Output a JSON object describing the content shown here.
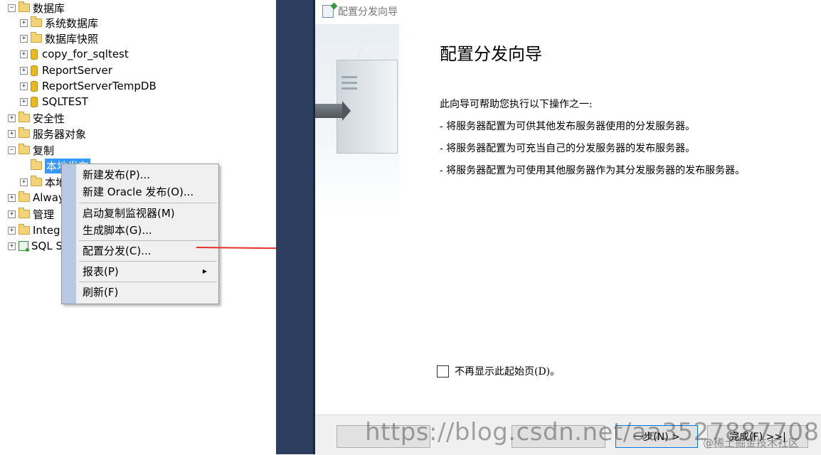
{
  "tree": {
    "databases": "数据库",
    "system_dbs": "系统数据库",
    "db_snapshots": "数据库快照",
    "db1": "copy_for_sqltest",
    "db2": "ReportServer",
    "db3": "ReportServerTempDB",
    "db4": "SQLTEST",
    "security": "安全性",
    "server_objects": "服务器对象",
    "replication": "复制",
    "local_publications": "本地发布",
    "local_subscriptions": "本地",
    "alwayson": "Alway",
    "management": "管理",
    "integration": "Integ",
    "sql_agent": "SQL S"
  },
  "context_menu": {
    "new_publication": "新建发布(P)...",
    "new_oracle_publication": "新建 Oracle 发布(O)...",
    "launch_monitor": "启动复制监视器(M)",
    "generate_scripts": "生成脚本(G)...",
    "configure_distribution": "配置分发(C)...",
    "reports": "报表(P)",
    "refresh": "刷新(F)"
  },
  "wizard": {
    "window_title": "配置分发向导",
    "heading": "配置分发向导",
    "intro": "此向导可帮助您执行以下操作之一:",
    "bullets": [
      "- 将服务器配置为可供其他发布服务器使用的分发服务器。",
      "- 将服务器配置为可充当自己的分发服务器的发布服务器。",
      "- 将服务器配置为可使用其他服务器作为其分发服务器的发布服务器。"
    ],
    "checkbox_label": "不再显示此起始页(D)。",
    "checkbox_checked": false,
    "buttons": {
      "next": "一步(N) >",
      "finish": "完成(F) >>|"
    }
  },
  "watermark": {
    "url": "https://blog.csdn.net/aa352788770871",
    "community": "@稀土掘金技术社区"
  },
  "colors": {
    "strip": "#2d3d5d",
    "selection": "#3399ff",
    "arrow": "#e8302a"
  }
}
